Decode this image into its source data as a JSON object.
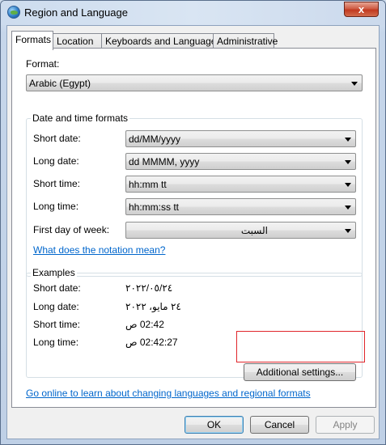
{
  "window": {
    "title": "Region and Language",
    "close_label": "x"
  },
  "tabs": [
    {
      "label": "Formats",
      "active": true
    },
    {
      "label": "Location",
      "active": false
    },
    {
      "label": "Keyboards and Languages",
      "active": false
    },
    {
      "label": "Administrative",
      "active": false
    }
  ],
  "format": {
    "label": "Format:",
    "value": "Arabic (Egypt)"
  },
  "date_time": {
    "group_title": "Date and time formats",
    "short_date": {
      "label": "Short date:",
      "value": "dd/MM/yyyy"
    },
    "long_date": {
      "label": "Long date:",
      "value": "dd MMMM, yyyy"
    },
    "short_time": {
      "label": "Short time:",
      "value": "hh:mm tt"
    },
    "long_time": {
      "label": "Long time:",
      "value": "hh:mm:ss tt"
    },
    "first_day": {
      "label": "First day of week:",
      "value": "السبت"
    },
    "notation_link": "What does the notation mean?"
  },
  "examples": {
    "group_title": "Examples",
    "short_date": {
      "label": "Short date:",
      "value": "٢٠٢٢/٠٥/٢٤"
    },
    "long_date": {
      "label": "Long date:",
      "value": "٢٤ مايو، ٢٠٢٢"
    },
    "short_time": {
      "label": "Short time:",
      "value": "02:42 ص"
    },
    "long_time": {
      "label": "Long time:",
      "value": "02:42:27 ص"
    }
  },
  "additional_settings_label": "Additional settings...",
  "online_link": "Go online to learn about changing languages and regional formats",
  "buttons": {
    "ok": "OK",
    "cancel": "Cancel",
    "apply": "Apply"
  },
  "colors": {
    "link": "#0066cc",
    "highlight": "#e0262b"
  }
}
